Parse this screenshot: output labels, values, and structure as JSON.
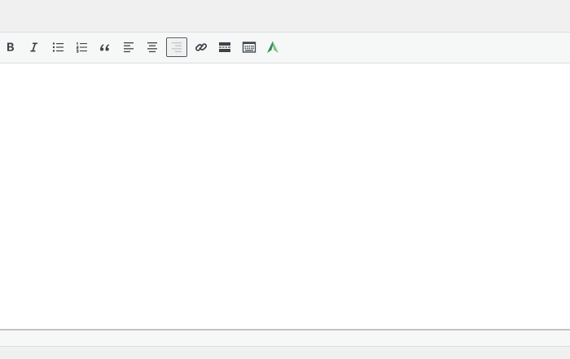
{
  "toolbar": {
    "buttons": [
      {
        "id": "bold",
        "icon": "bold-icon",
        "active": false
      },
      {
        "id": "italic",
        "icon": "italic-icon",
        "active": false
      },
      {
        "id": "bulleted-list",
        "icon": "bulleted-list-icon",
        "active": false
      },
      {
        "id": "numbered-list",
        "icon": "numbered-list-icon",
        "active": false
      },
      {
        "id": "blockquote",
        "icon": "blockquote-icon",
        "active": false
      },
      {
        "id": "align-left",
        "icon": "align-left-icon",
        "active": false
      },
      {
        "id": "align-center",
        "icon": "align-center-icon",
        "active": false
      },
      {
        "id": "align-right",
        "icon": "align-right-icon",
        "active": true
      },
      {
        "id": "insert-link",
        "icon": "link-icon",
        "active": false
      },
      {
        "id": "insert-more",
        "icon": "read-more-icon",
        "active": false
      },
      {
        "id": "toolbar-toggle",
        "icon": "keyboard-icon",
        "active": false
      },
      {
        "id": "plugin",
        "icon": "green-a-logo-icon",
        "active": false
      }
    ]
  },
  "editor": {
    "content": ""
  },
  "colors": {
    "icon": "#3c434a",
    "plugin_green_dark": "#2e8b57",
    "plugin_green_light": "#7ac47f",
    "editor_bg": "#ffffff",
    "toolbar_bg": "#f6f7f7",
    "page_bg": "#f0f0f1"
  }
}
